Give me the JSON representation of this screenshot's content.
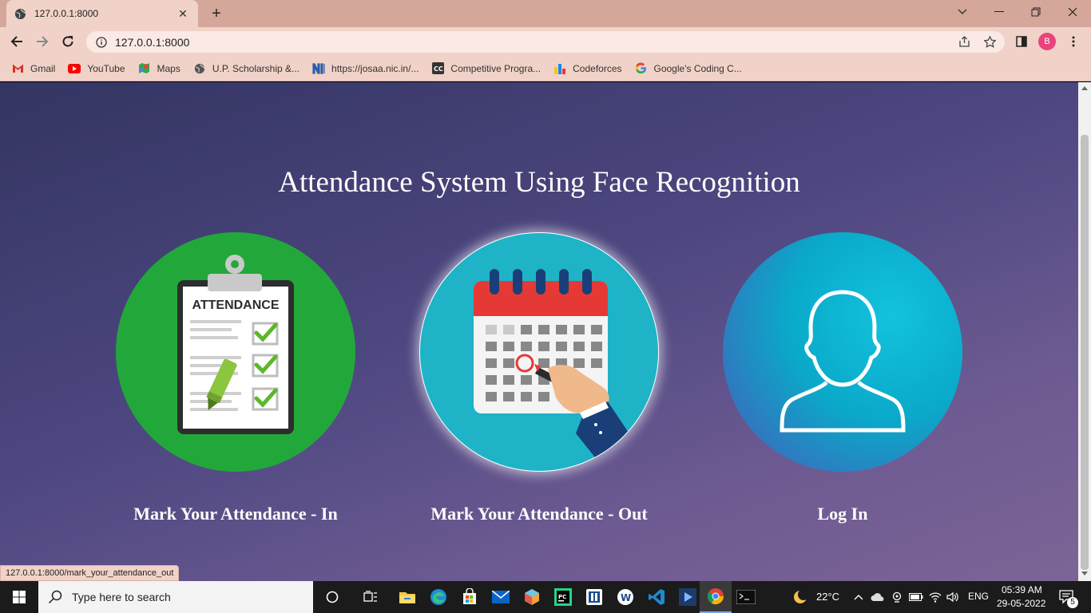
{
  "browser": {
    "tab_title": "127.0.0.1:8000",
    "url": "127.0.0.1:8000",
    "profile_initial": "B",
    "bookmarks": [
      {
        "label": "Gmail",
        "icon": "gmail-icon"
      },
      {
        "label": "YouTube",
        "icon": "youtube-icon"
      },
      {
        "label": "Maps",
        "icon": "maps-icon"
      },
      {
        "label": "U.P. Scholarship &...",
        "icon": "globe-icon"
      },
      {
        "label": "https://josaa.nic.in/...",
        "icon": "nic-icon"
      },
      {
        "label": "Competitive Progra...",
        "icon": "cc-icon"
      },
      {
        "label": "Codeforces",
        "icon": "codeforces-icon"
      },
      {
        "label": "Google's Coding C...",
        "icon": "google-icon"
      }
    ],
    "status_url": "127.0.0.1:8000/mark_your_attendance_out"
  },
  "page": {
    "heading": "Attendance System Using Face Recognition",
    "cards": [
      {
        "label": "Mark Your Attendance - In",
        "icon": "attendance-clipboard-icon"
      },
      {
        "label": "Mark Your Attendance - Out",
        "icon": "calendar-icon"
      },
      {
        "label": "Log In",
        "icon": "user-icon"
      }
    ],
    "clipboard_text": "ATTENDANCE"
  },
  "taskbar": {
    "search_placeholder": "Type here to search",
    "temperature": "22°C",
    "language": "ENG",
    "time": "05:39 AM",
    "date": "29-05-2022",
    "notification_count": "5"
  },
  "colors": {
    "chrome_frame": "#d4a79a",
    "chrome_toolbar": "#f1d2c8",
    "page_gradient_start": "#343563",
    "page_gradient_end": "#7c6596",
    "card_in": "#22a83a",
    "card_out": "#1fb3c7",
    "card_login": "#0fb6d0"
  }
}
